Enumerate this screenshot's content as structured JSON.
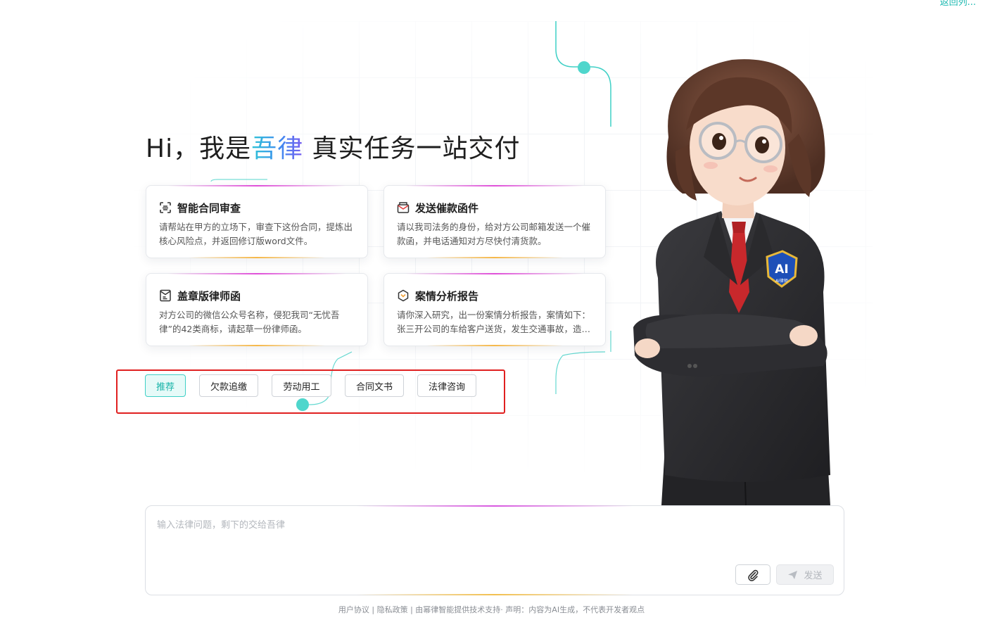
{
  "top_link": "返回列...",
  "hero": {
    "prefix": "Hi，我是",
    "brand": "吾律",
    "suffix": " 真实任务一站交付"
  },
  "cards": [
    {
      "icon": "scan-document-icon",
      "title": "智能合同审查",
      "desc": "请帮站在甲方的立场下，审查下这份合同，提炼出核心风险点，并返回修订版word文件。"
    },
    {
      "icon": "mail-icon",
      "title": "发送催款函件",
      "desc": "请以我司法务的身份，给对方公司邮箱发送一个催款函，并电话通知对方尽快付清货款。"
    },
    {
      "icon": "stamped-letter-icon",
      "title": "盖章版律师函",
      "desc": "对方公司的微信公众号名称，侵犯我司“无忧吾律”的42类商标，请起草一份律师函。"
    },
    {
      "icon": "case-report-icon",
      "title": "案情分析报告",
      "desc": "请你深入研究，出一份案情分析报告，案情如下： 张三开公司的车给客户送货，发生交通事故，造成他人受伤，现在伤者要求赔偿，请分析责任承担。"
    }
  ],
  "tags": [
    {
      "label": "推荐",
      "active": true
    },
    {
      "label": "欠款追缴",
      "active": false
    },
    {
      "label": "劳动用工",
      "active": false
    },
    {
      "label": "合同文书",
      "active": false
    },
    {
      "label": "法律咨询",
      "active": false
    }
  ],
  "avatar": {
    "badge_main": "AI",
    "badge_sub": "AI律师"
  },
  "input": {
    "placeholder": "输入法律问题，剩下的交给吾律",
    "value": "",
    "send_label": "发送",
    "attach_icon": "paperclip-icon",
    "send_icon": "send-plane-icon"
  },
  "footer": "用户协议 | 隐私政策 | 由幂律智能提供技术支持· 声明：内容为AI生成，不代表开发者观点",
  "colors": {
    "accent": "#1ab8b0",
    "brand_gradient_start": "#2ec4d6",
    "brand_gradient_end": "#7a5cf0",
    "highlight_box": "#e02020"
  }
}
